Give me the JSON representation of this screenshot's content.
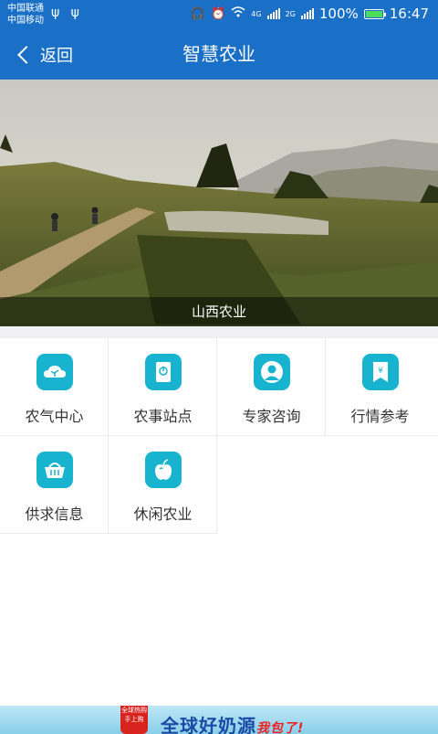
{
  "status_bar": {
    "carrier_1": "中国联通",
    "carrier_2": "中国移动",
    "usb_icons": "ψ ψ",
    "network_1": "4G",
    "network_2": "2G",
    "battery": "100%",
    "time": "16:47"
  },
  "nav": {
    "back_label": "返回",
    "title": "智慧农业"
  },
  "banner": {
    "caption": "山西农业"
  },
  "menu": {
    "items": [
      {
        "label": "农气中心",
        "icon": "cloud-sprout-icon"
      },
      {
        "label": "农事站点",
        "icon": "phone-power-icon"
      },
      {
        "label": "专家咨询",
        "icon": "expert-avatar-icon"
      },
      {
        "label": "行情参考",
        "icon": "price-tag-yen-icon"
      },
      {
        "label": "供求信息",
        "icon": "basket-icon"
      },
      {
        "label": "休闲农业",
        "icon": "apple-icon"
      }
    ]
  },
  "ad": {
    "badge_line1": "全球热购",
    "badge_line2": "手上购",
    "headline": "全球好奶源",
    "tagline": "我包了!"
  },
  "colors": {
    "primary": "#1a6fc6",
    "icon_bg": "#17b3cf",
    "divider": "#efeff4"
  }
}
